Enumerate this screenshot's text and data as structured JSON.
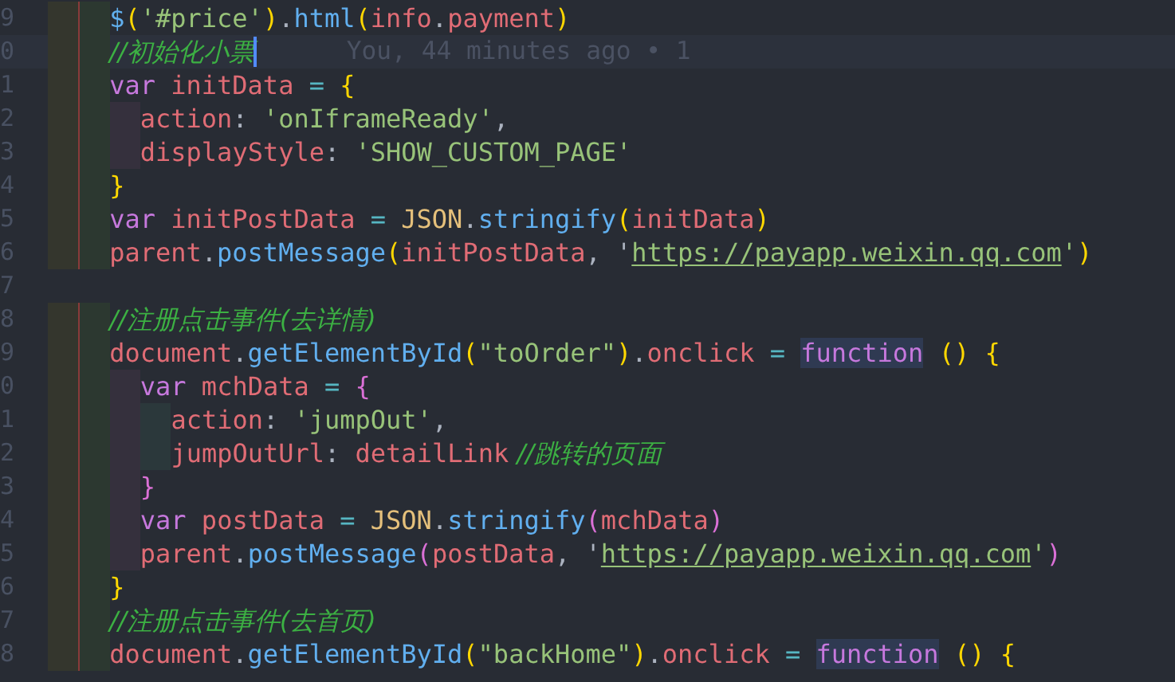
{
  "editor": {
    "lines": [
      {
        "number": "9",
        "current": false,
        "guides": [
          {
            "kind": "outer"
          },
          {
            "kind": "inner"
          }
        ],
        "tokens": [
          {
            "kind": "fn",
            "text": "$"
          },
          {
            "kind": "b1",
            "text": "("
          },
          {
            "kind": "str",
            "text": "'#price'"
          },
          {
            "kind": "b1",
            "text": ")"
          },
          {
            "kind": "plain",
            "text": "."
          },
          {
            "kind": "fn",
            "text": "html"
          },
          {
            "kind": "b1",
            "text": "("
          },
          {
            "kind": "var",
            "text": "info"
          },
          {
            "kind": "plain",
            "text": "."
          },
          {
            "kind": "var",
            "text": "payment"
          },
          {
            "kind": "b1",
            "text": ")"
          }
        ]
      },
      {
        "number": "0",
        "current": true,
        "blame": "You, 44 minutes ago • 1",
        "guides": [
          {
            "kind": "outer"
          },
          {
            "kind": "inner"
          }
        ],
        "tokens": [
          {
            "kind": "comment",
            "text": "//初始化小票"
          }
        ]
      },
      {
        "number": "1",
        "current": false,
        "guides": [
          {
            "kind": "outer"
          },
          {
            "kind": "inner"
          }
        ],
        "tokens": [
          {
            "kind": "kw",
            "text": "var"
          },
          {
            "kind": "var",
            "text": " initData"
          },
          {
            "kind": "op",
            "text": " ="
          },
          {
            "kind": "b1",
            "text": " {"
          }
        ]
      },
      {
        "number": "2",
        "current": false,
        "guides": [
          {
            "kind": "outer"
          },
          {
            "kind": "inner"
          },
          {
            "kind": "third"
          }
        ],
        "tokens": [
          {
            "kind": "var",
            "text": "action"
          },
          {
            "kind": "plain",
            "text": ": "
          },
          {
            "kind": "str",
            "text": "'onIframeReady'"
          },
          {
            "kind": "plain",
            "text": ","
          }
        ]
      },
      {
        "number": "3",
        "current": false,
        "guides": [
          {
            "kind": "outer"
          },
          {
            "kind": "inner"
          },
          {
            "kind": "third"
          }
        ],
        "tokens": [
          {
            "kind": "var",
            "text": "displayStyle"
          },
          {
            "kind": "plain",
            "text": ": "
          },
          {
            "kind": "str",
            "text": "'SHOW_CUSTOM_PAGE'"
          }
        ]
      },
      {
        "number": "4",
        "current": false,
        "guides": [
          {
            "kind": "outer"
          },
          {
            "kind": "inner"
          }
        ],
        "tokens": [
          {
            "kind": "b1",
            "text": "}"
          }
        ]
      },
      {
        "number": "5",
        "current": false,
        "guides": [
          {
            "kind": "outer"
          },
          {
            "kind": "inner"
          }
        ],
        "tokens": [
          {
            "kind": "kw",
            "text": "var"
          },
          {
            "kind": "var",
            "text": " initPostData"
          },
          {
            "kind": "op",
            "text": " = "
          },
          {
            "kind": "cls",
            "text": "JSON"
          },
          {
            "kind": "plain",
            "text": "."
          },
          {
            "kind": "fn",
            "text": "stringify"
          },
          {
            "kind": "b1",
            "text": "("
          },
          {
            "kind": "var",
            "text": "initData"
          },
          {
            "kind": "b1",
            "text": ")"
          }
        ]
      },
      {
        "number": "6",
        "current": false,
        "guides": [
          {
            "kind": "outer"
          },
          {
            "kind": "inner"
          }
        ],
        "tokens": [
          {
            "kind": "var",
            "text": "parent"
          },
          {
            "kind": "plain",
            "text": "."
          },
          {
            "kind": "fn",
            "text": "postMessage"
          },
          {
            "kind": "b1",
            "text": "("
          },
          {
            "kind": "var",
            "text": "initPostData"
          },
          {
            "kind": "plain",
            "text": ", '"
          },
          {
            "kind": "url",
            "text": "https://payapp.weixin.qq.com"
          },
          {
            "kind": "str",
            "text": "'"
          },
          {
            "kind": "b1",
            "text": ")"
          }
        ]
      },
      {
        "number": "7",
        "current": false
      },
      {
        "number": "8",
        "current": false,
        "guides": [
          {
            "kind": "outer"
          },
          {
            "kind": "inner"
          }
        ],
        "tokens": [
          {
            "kind": "comment",
            "text": "//注册点击事件(去详情)"
          }
        ]
      },
      {
        "number": "9",
        "current": false,
        "guides": [
          {
            "kind": "outer"
          },
          {
            "kind": "inner"
          }
        ],
        "tokens": [
          {
            "kind": "var",
            "text": "document"
          },
          {
            "kind": "plain",
            "text": "."
          },
          {
            "kind": "fn",
            "text": "getElementById"
          },
          {
            "kind": "b1",
            "text": "("
          },
          {
            "kind": "str",
            "text": "\"toOrder\""
          },
          {
            "kind": "b1",
            "text": ")"
          },
          {
            "kind": "plain",
            "text": "."
          },
          {
            "kind": "var",
            "text": "onclick"
          },
          {
            "kind": "op",
            "text": " = "
          },
          {
            "kind": "hl",
            "text": "function"
          },
          {
            "kind": "b1",
            "text": " () {"
          }
        ]
      },
      {
        "number": "0",
        "current": false,
        "guides": [
          {
            "kind": "outer"
          },
          {
            "kind": "inner"
          },
          {
            "kind": "third"
          }
        ],
        "tokens": [
          {
            "kind": "kw",
            "text": "var"
          },
          {
            "kind": "var",
            "text": " mchData"
          },
          {
            "kind": "op",
            "text": " ="
          },
          {
            "kind": "b2",
            "text": " {"
          }
        ]
      },
      {
        "number": "1",
        "current": false,
        "guides": [
          {
            "kind": "outer"
          },
          {
            "kind": "inner"
          },
          {
            "kind": "third"
          },
          {
            "kind": "fourth"
          }
        ],
        "tokens": [
          {
            "kind": "var",
            "text": "action"
          },
          {
            "kind": "plain",
            "text": ": "
          },
          {
            "kind": "str",
            "text": "'jumpOut'"
          },
          {
            "kind": "plain",
            "text": ","
          }
        ]
      },
      {
        "number": "2",
        "current": false,
        "guides": [
          {
            "kind": "outer"
          },
          {
            "kind": "inner"
          },
          {
            "kind": "third"
          },
          {
            "kind": "fourth"
          }
        ],
        "tokens": [
          {
            "kind": "var",
            "text": "jumpOutUrl"
          },
          {
            "kind": "plain",
            "text": ": "
          },
          {
            "kind": "var",
            "text": "detailLink"
          },
          {
            "kind": "comment",
            "text": " //跳转的页面"
          }
        ]
      },
      {
        "number": "3",
        "current": false,
        "guides": [
          {
            "kind": "outer"
          },
          {
            "kind": "inner"
          },
          {
            "kind": "third"
          }
        ],
        "tokens": [
          {
            "kind": "b2",
            "text": "}"
          }
        ]
      },
      {
        "number": "4",
        "current": false,
        "guides": [
          {
            "kind": "outer"
          },
          {
            "kind": "inner"
          },
          {
            "kind": "third"
          }
        ],
        "tokens": [
          {
            "kind": "kw",
            "text": "var"
          },
          {
            "kind": "var",
            "text": " postData"
          },
          {
            "kind": "op",
            "text": " = "
          },
          {
            "kind": "cls",
            "text": "JSON"
          },
          {
            "kind": "plain",
            "text": "."
          },
          {
            "kind": "fn",
            "text": "stringify"
          },
          {
            "kind": "b2",
            "text": "("
          },
          {
            "kind": "var",
            "text": "mchData"
          },
          {
            "kind": "b2",
            "text": ")"
          }
        ]
      },
      {
        "number": "5",
        "current": false,
        "guides": [
          {
            "kind": "outer"
          },
          {
            "kind": "inner"
          },
          {
            "kind": "third"
          }
        ],
        "tokens": [
          {
            "kind": "var",
            "text": "parent"
          },
          {
            "kind": "plain",
            "text": "."
          },
          {
            "kind": "fn",
            "text": "postMessage"
          },
          {
            "kind": "b2",
            "text": "("
          },
          {
            "kind": "var",
            "text": "postData"
          },
          {
            "kind": "plain",
            "text": ", '"
          },
          {
            "kind": "url",
            "text": "https://payapp.weixin.qq.com"
          },
          {
            "kind": "str",
            "text": "'"
          },
          {
            "kind": "b2",
            "text": ")"
          }
        ]
      },
      {
        "number": "6",
        "current": false,
        "guides": [
          {
            "kind": "outer"
          },
          {
            "kind": "inner"
          }
        ],
        "tokens": [
          {
            "kind": "b1",
            "text": "}"
          }
        ]
      },
      {
        "number": "7",
        "current": false,
        "guides": [
          {
            "kind": "outer"
          },
          {
            "kind": "inner"
          }
        ],
        "tokens": [
          {
            "kind": "comment",
            "text": "//注册点击事件(去首页)"
          }
        ]
      },
      {
        "number": "8",
        "current": false,
        "guides": [
          {
            "kind": "outer"
          },
          {
            "kind": "inner"
          }
        ],
        "tokens": [
          {
            "kind": "var",
            "text": "document"
          },
          {
            "kind": "plain",
            "text": "."
          },
          {
            "kind": "fn",
            "text": "getElementById"
          },
          {
            "kind": "b1",
            "text": "("
          },
          {
            "kind": "str",
            "text": "\"backHome\""
          },
          {
            "kind": "b1",
            "text": ")"
          },
          {
            "kind": "plain",
            "text": "."
          },
          {
            "kind": "var",
            "text": "onclick"
          },
          {
            "kind": "op",
            "text": " = "
          },
          {
            "kind": "hl",
            "text": "function"
          },
          {
            "kind": "b1",
            "text": " () {"
          }
        ]
      }
    ]
  }
}
